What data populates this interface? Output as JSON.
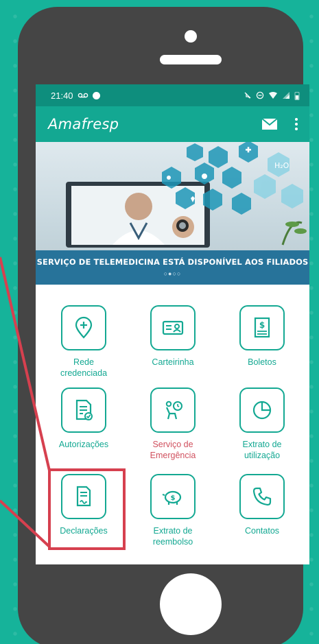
{
  "status_bar": {
    "time": "21:40",
    "left_icons": [
      "voicemail-icon",
      "circle-dot-icon"
    ],
    "right_icons": [
      "mute-icon",
      "dnd-icon",
      "wifi-icon",
      "signal-icon",
      "battery-icon"
    ]
  },
  "app_bar": {
    "logo": "Amafresp",
    "actions": [
      "mail-icon",
      "more-vert-icon"
    ]
  },
  "banner": {
    "title": "SERVIÇO DE TELEMEDICINA ESTÁ DISPONÍVEL AOS FILIADOS",
    "pager": "○●○○",
    "icons": [
      "h2o-icon",
      "plus-icon",
      "heart-icon",
      "stethoscope-icon",
      "accessibility-icon",
      "eye-icon",
      "test-tube-icon",
      "document-icon"
    ]
  },
  "menu": [
    {
      "label": "Rede\ncredenciada",
      "icon": "location-pin-plus-icon",
      "color": "#13a892"
    },
    {
      "label": "Carteirinha",
      "icon": "id-card-icon",
      "color": "#13a892"
    },
    {
      "label": "Boletos",
      "icon": "bill-icon",
      "color": "#13a892"
    },
    {
      "label": "Autorizações",
      "icon": "document-check-icon",
      "color": "#13a892"
    },
    {
      "label": "Serviço de\nEmergência",
      "icon": "emergency-person-icon",
      "color": "#d0505e"
    },
    {
      "label": "Extrato de\nutilização",
      "icon": "pie-chart-icon",
      "color": "#13a892"
    },
    {
      "label": "Declarações",
      "icon": "declaration-document-icon",
      "color": "#13a892",
      "highlighted": true
    },
    {
      "label": "Extrato de\nreembolso",
      "icon": "piggy-bank-icon",
      "color": "#13a892"
    },
    {
      "label": "Contatos",
      "icon": "phone-icon",
      "color": "#13a892"
    }
  ],
  "colors": {
    "accent": "#13a892",
    "status_bar": "#0e8e7d",
    "banner_caption": "#27739a",
    "highlight": "#d6404f",
    "background": "#16b39a",
    "phone_body": "#454545"
  }
}
